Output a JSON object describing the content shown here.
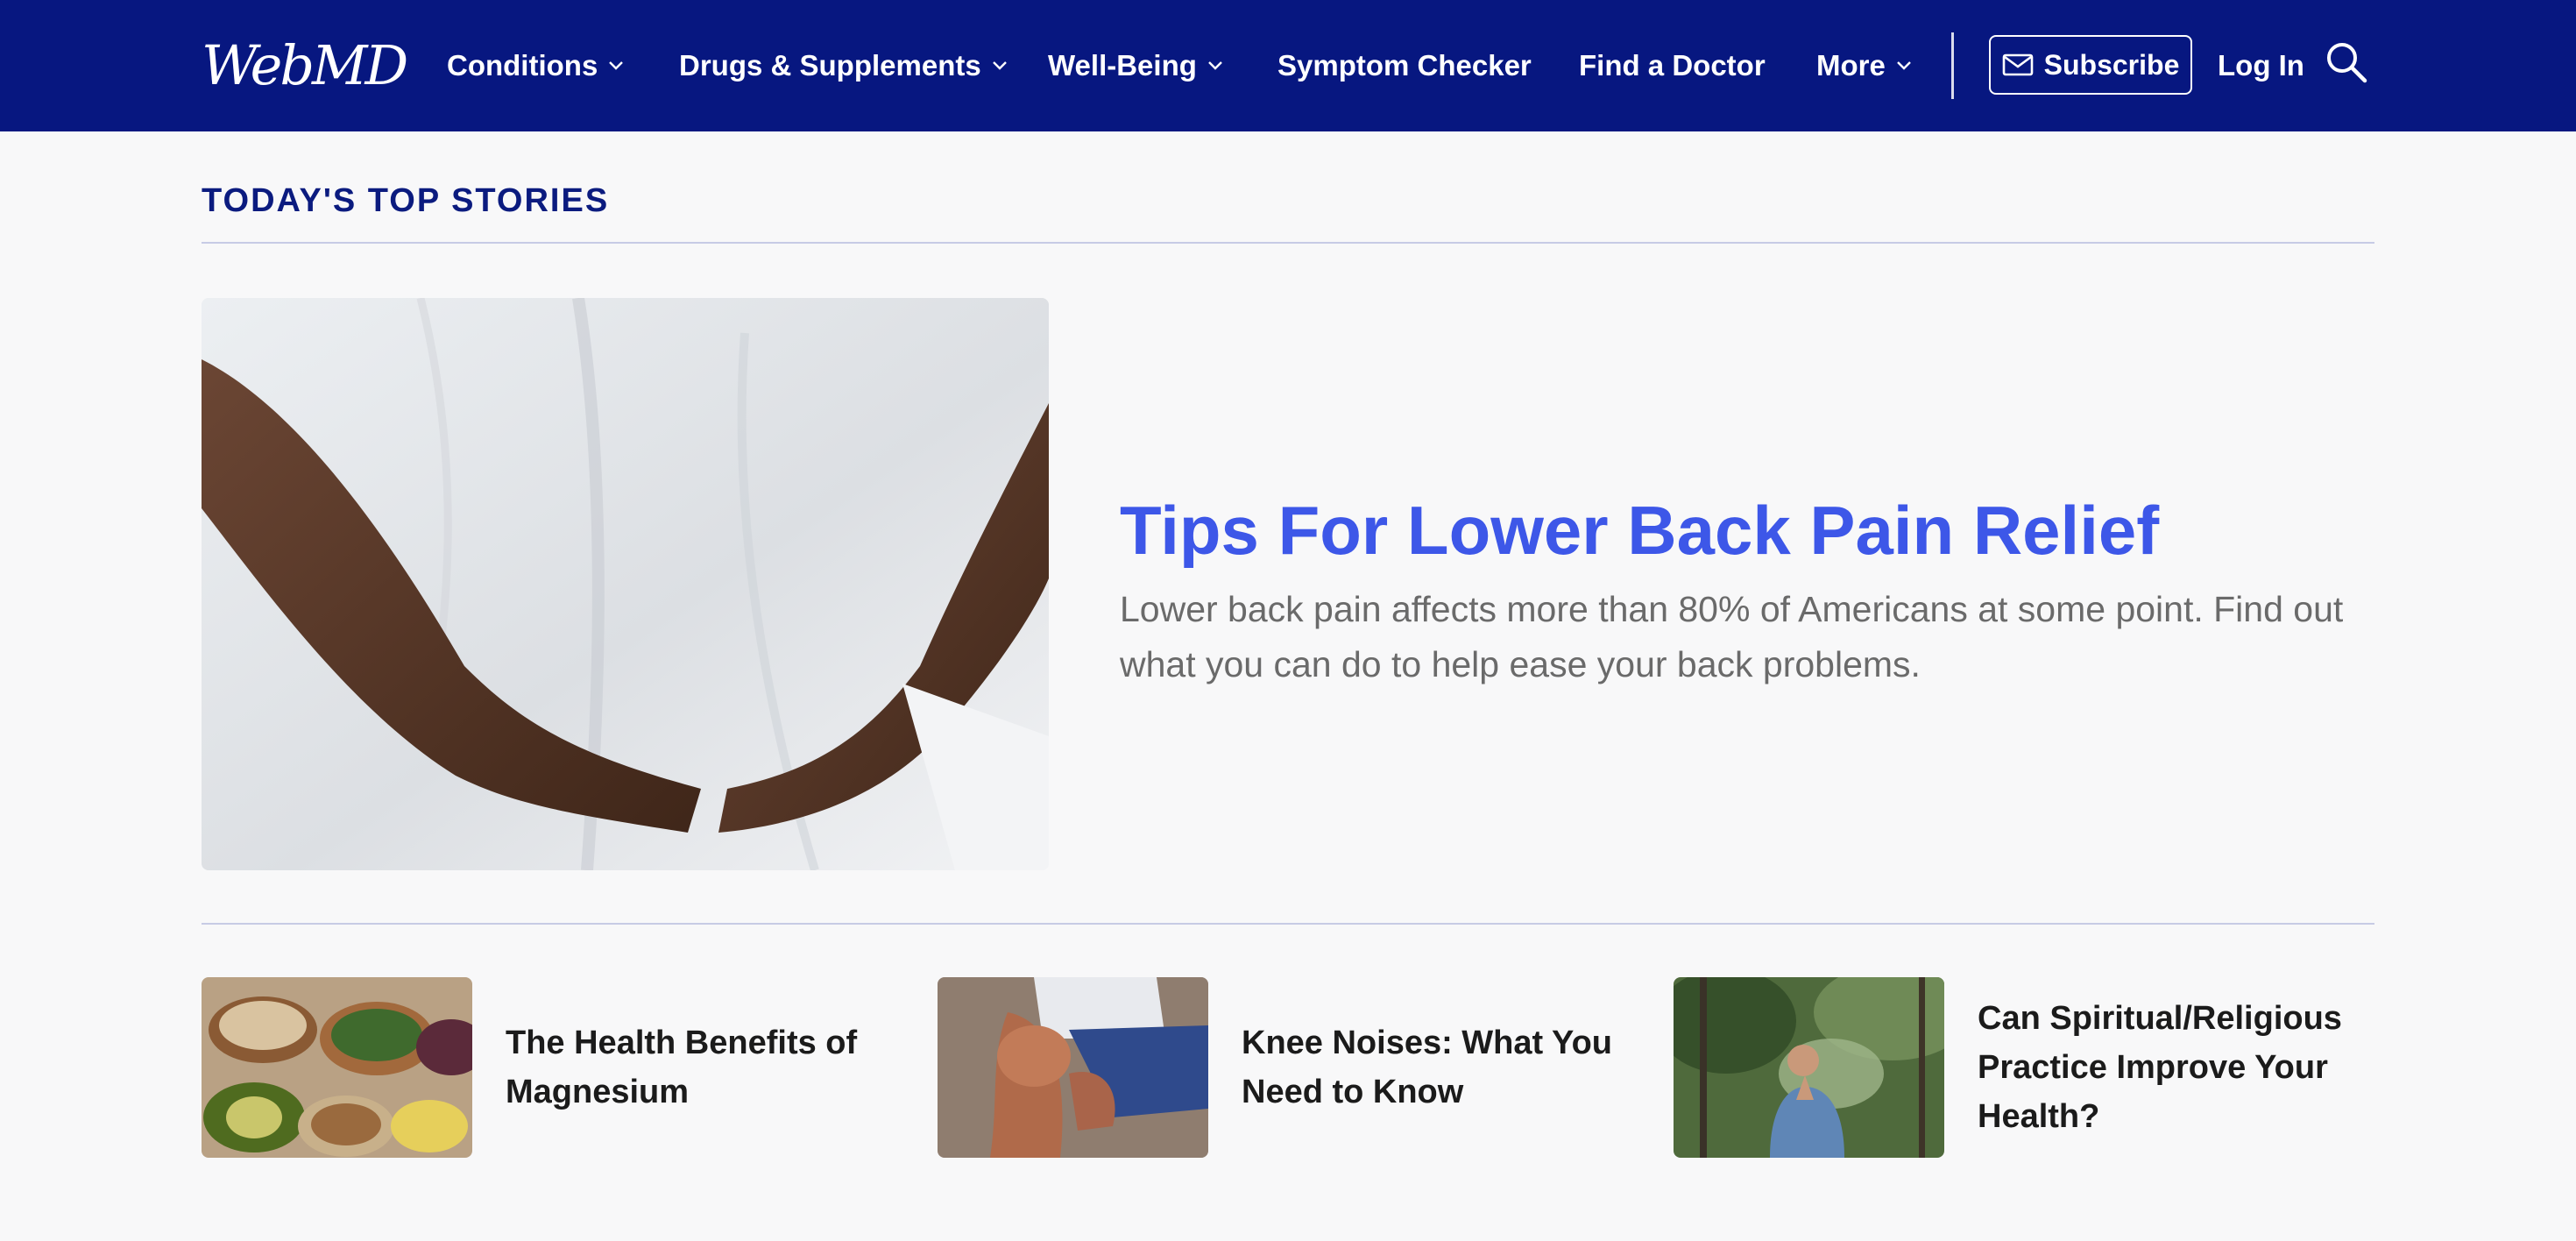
{
  "header": {
    "logo": "WebMD",
    "nav": [
      {
        "label": "Conditions",
        "has_dropdown": true
      },
      {
        "label": "Drugs & Supplements",
        "has_dropdown": true
      },
      {
        "label": "Well-Being",
        "has_dropdown": true
      },
      {
        "label": "Symptom Checker",
        "has_dropdown": false
      },
      {
        "label": "Find a Doctor",
        "has_dropdown": false
      },
      {
        "label": "More",
        "has_dropdown": true
      }
    ],
    "subscribe_label": "Subscribe",
    "login_label": "Log In",
    "icons": {
      "dropdown": "chevron-down-icon",
      "subscribe": "mail-icon",
      "search": "search-icon"
    }
  },
  "section": {
    "title": "TODAY'S TOP STORIES"
  },
  "hero": {
    "title": "Tips For Lower Back Pain Relief",
    "description": "Lower back pain affects more than 80% of Americans at some point. Find out what you can do to help ease your back problems."
  },
  "stories": [
    {
      "title": "The Health Benefits of Magnesium"
    },
    {
      "title": "Knee Noises: What You Need to Know"
    },
    {
      "title": "Can Spiritual/Religious Practice Improve Your Health?"
    }
  ],
  "colors": {
    "header_bg": "#071780",
    "section_title": "#0b1b7f",
    "hero_title": "#3d57e8",
    "page_bg": "#f8f8f9"
  }
}
